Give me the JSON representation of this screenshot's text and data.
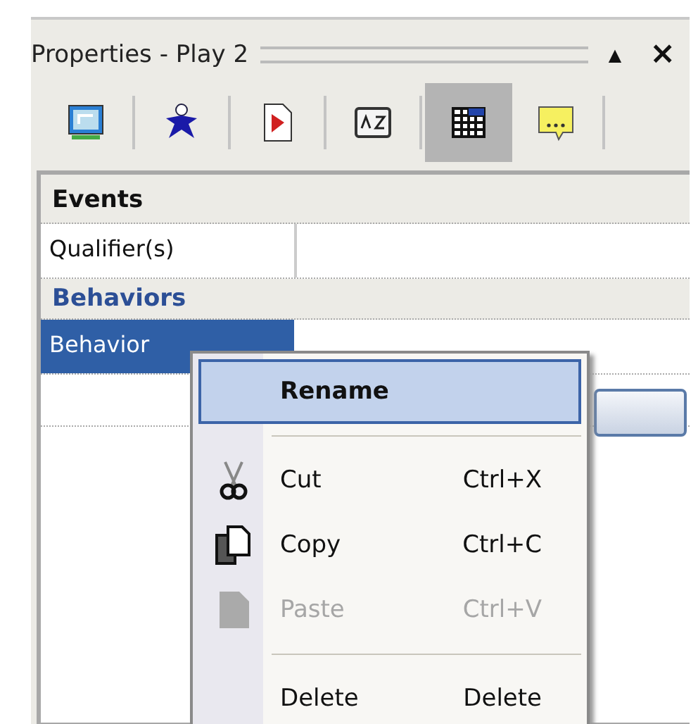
{
  "panel": {
    "title": "Properties - Play 2",
    "pin_glyph": "▲",
    "close_glyph": "×"
  },
  "toolbar": [
    {
      "kind": "monitor",
      "selected": false
    },
    {
      "kind": "figure",
      "selected": false
    },
    {
      "kind": "media",
      "selected": false
    },
    {
      "kind": "sort",
      "selected": false
    },
    {
      "kind": "grid",
      "selected": true
    },
    {
      "kind": "note",
      "selected": false
    }
  ],
  "grid_rows": [
    {
      "kind": "header",
      "label": "Events"
    },
    {
      "kind": "property",
      "label": "Qualifier(s)",
      "selected": false
    },
    {
      "kind": "category",
      "label": "Behaviors"
    },
    {
      "kind": "property",
      "label": "Behavior",
      "selected": true
    },
    {
      "kind": "blank"
    }
  ],
  "context_menu": {
    "items": [
      {
        "kind": "default",
        "label": "Rename",
        "selected": true,
        "disabled": false
      },
      {
        "kind": "separator"
      },
      {
        "kind": "cut",
        "label": "Cut",
        "shortcut": "Ctrl+X",
        "selected": false,
        "disabled": false
      },
      {
        "kind": "copy",
        "label": "Copy",
        "shortcut": "Ctrl+C",
        "selected": false,
        "disabled": false
      },
      {
        "kind": "paste",
        "label": "Paste",
        "shortcut": "Ctrl+V",
        "selected": false,
        "disabled": true
      },
      {
        "kind": "separator"
      },
      {
        "kind": "plain",
        "label": "Delete",
        "shortcut": "Delete",
        "selected": false,
        "disabled": false
      }
    ]
  }
}
